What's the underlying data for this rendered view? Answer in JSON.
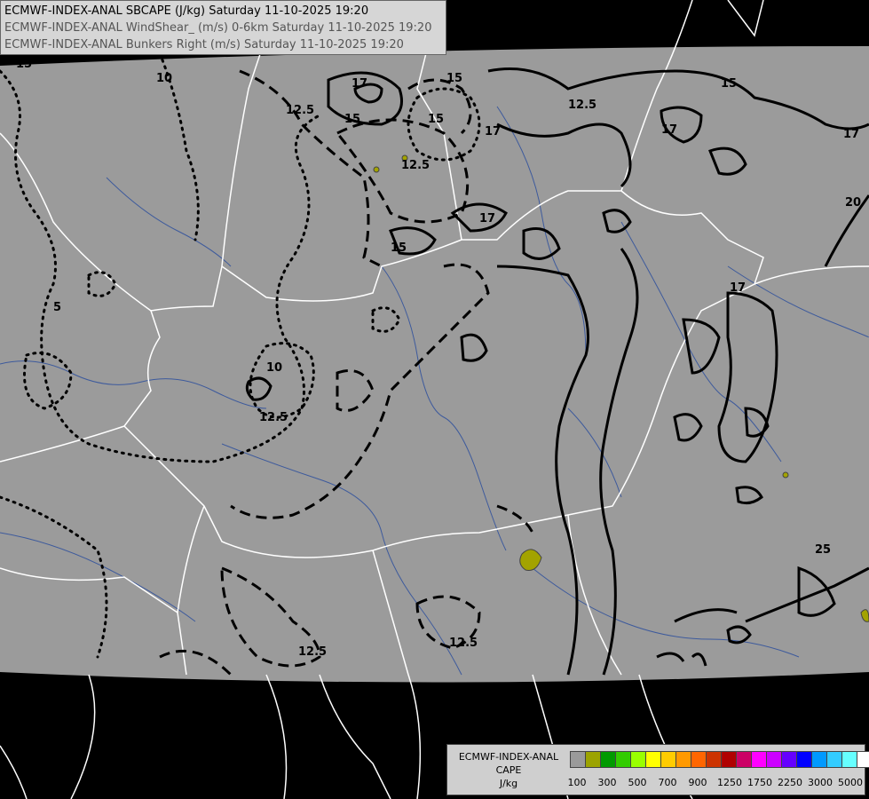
{
  "header": {
    "line1": "ECMWF-INDEX-ANAL SBCAPE (J/kg) Saturday 11-10-2025 19:20",
    "line2": "ECMWF-INDEX-ANAL WindShear_ (m/s) 0-6km Saturday 11-10-2025 19:20",
    "line3": "ECMWF-INDEX-ANAL Bunkers Right (m/s) Saturday 11-10-2025 19:20"
  },
  "legend": {
    "line1": "ECMWF-INDEX-ANAL",
    "line2": "CAPE",
    "line3": "J/kg",
    "colors": [
      "#9a9a9a",
      "#9ca300",
      "#009a00",
      "#33cc00",
      "#99ff00",
      "#ffff00",
      "#ffcc00",
      "#ff9900",
      "#ff6600",
      "#cc3300",
      "#b00000",
      "#cc0066",
      "#ff00ff",
      "#cc00ff",
      "#6600ff",
      "#0000ff",
      "#0099ff",
      "#33ccff",
      "#66ffff",
      "#ffffff"
    ],
    "tick_labels": [
      "100",
      "300",
      "500",
      "700",
      "900",
      "1250",
      "1750",
      "2250",
      "3000",
      "5000"
    ]
  },
  "map_labels": {
    "contours": [
      "15",
      "10",
      "12.5",
      "17",
      "15",
      "12.5",
      "15",
      "15",
      "12.5",
      "17",
      "15",
      "17",
      "17",
      "15",
      "17",
      "20",
      "17",
      "5",
      "10",
      "12.5",
      "12.5",
      "12.5",
      "25"
    ]
  }
}
